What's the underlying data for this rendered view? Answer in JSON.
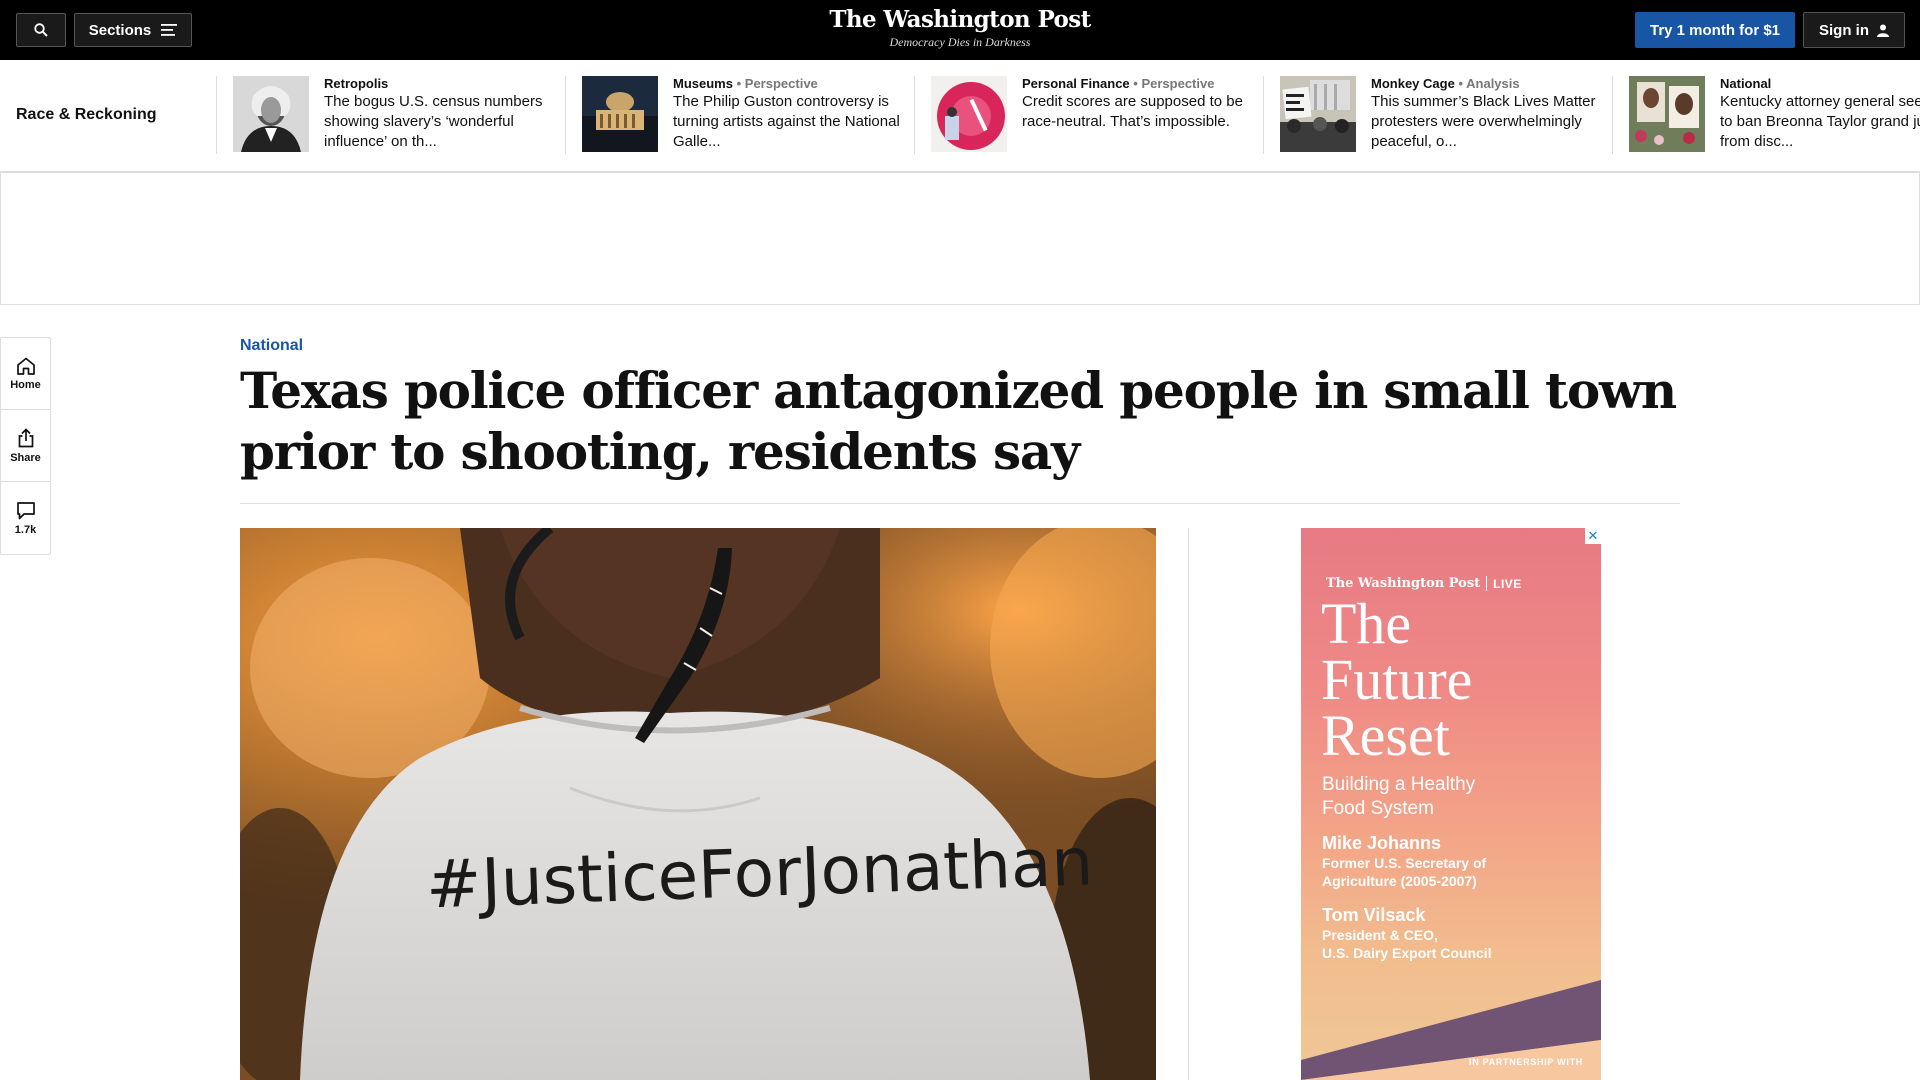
{
  "header": {
    "sections_label": "Sections",
    "brand_name": "The Washington Post",
    "tagline": "Democracy Dies in Darkness",
    "subscribe_label": "Try 1 month for $1",
    "signin_label": "Sign in",
    "colors": {
      "bar": "#000000",
      "subscribe": "#1955a5"
    }
  },
  "related": {
    "title": "Race & Reckoning",
    "items": [
      {
        "kicker": "Retropolis",
        "label": "",
        "headline": "The bogus U.S. census numbers showing slavery’s ‘wonderful influence’ on th..."
      },
      {
        "kicker": "Museums",
        "label": "Perspective",
        "headline": "The Philip Guston controversy is turning artists against the National Galle..."
      },
      {
        "kicker": "Personal Finance",
        "label": "Perspective",
        "headline": "Credit scores are supposed to be race-neutral. That’s impossible."
      },
      {
        "kicker": "Monkey Cage",
        "label": "Analysis",
        "headline": "This summer’s Black Lives Matter protesters were overwhelmingly peaceful, o..."
      },
      {
        "kicker": "National",
        "label": "",
        "headline": "Kentucky attorney general seeks to ban Breonna Taylor grand juror from disc..."
      }
    ]
  },
  "rail": {
    "home_label": "Home",
    "share_label": "Share",
    "comments_count": "1.7k"
  },
  "article": {
    "section": "National",
    "headline": "Texas police officer antagonized people in small town prior to shooting, residents say",
    "photo_text": "#JusticeForJonathan",
    "accent_color": "#1955a5"
  },
  "ad": {
    "close_label": "✕",
    "brand": "The Washington Post",
    "brand_suffix": "LIVE",
    "title_lines": [
      "The",
      "Future",
      "Reset"
    ],
    "subtitle_lines": [
      "Building a Healthy",
      "Food System"
    ],
    "people": [
      {
        "name": "Mike Johanns",
        "role_lines": [
          "Former U.S. Secretary of",
          "Agriculture (2005-2007)"
        ]
      },
      {
        "name": "Tom Vilsack",
        "role_lines": [
          "President & CEO,",
          "U.S. Dairy Export Council"
        ]
      }
    ],
    "partner": "IN PARTNERSHIP WITH"
  }
}
